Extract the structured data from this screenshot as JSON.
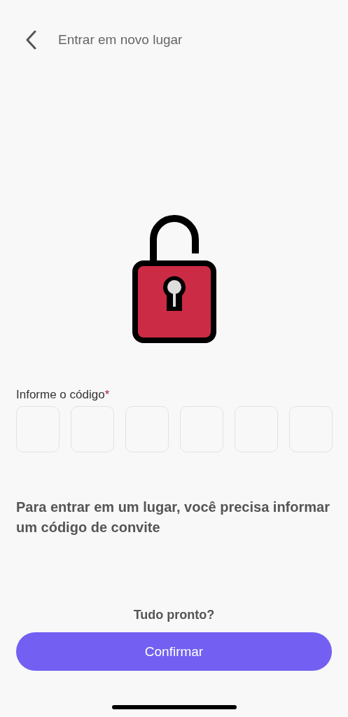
{
  "header": {
    "title": "Entrar em novo lugar"
  },
  "code": {
    "label": "Informe o código",
    "required_mark": "*",
    "fields": [
      {
        "kind": "digit"
      },
      {
        "kind": "digit"
      },
      {
        "kind": "digit"
      },
      {
        "kind": "digit"
      },
      {
        "kind": "digit"
      },
      {
        "kind": "digit"
      }
    ]
  },
  "message": "Para entrar em um lugar, você precisa informar um código de convite",
  "prompt": "Tudo pronto?",
  "confirm_button": {
    "label": "Confirmar"
  }
}
